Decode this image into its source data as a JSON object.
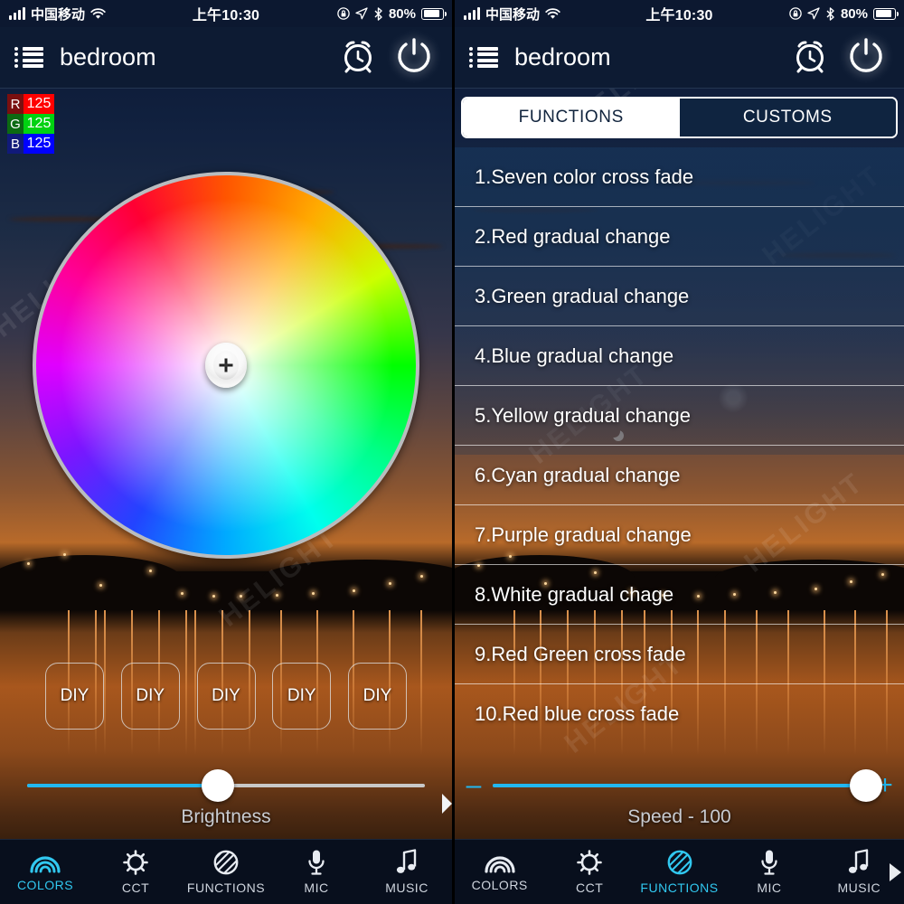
{
  "status_bar": {
    "carrier": "中国移动",
    "signal_icon": "cellular-signal-icon",
    "wifi_icon": "wifi-icon",
    "time": "上午10:30",
    "rotation_lock_icon": "rotation-lock-icon",
    "location_icon": "location-arrow-icon",
    "bluetooth_icon": "bluetooth-icon",
    "battery_percent": "80%",
    "battery_icon": "battery-icon"
  },
  "header": {
    "menu_icon": "hamburger-list-icon",
    "title": "bedroom",
    "alarm_icon": "alarm-clock-icon",
    "power_icon": "power-button-icon"
  },
  "left_panel": {
    "rgb": [
      {
        "channel": "R",
        "value": "125",
        "color": "#ff0000"
      },
      {
        "channel": "G",
        "value": "125",
        "color": "#00d211"
      },
      {
        "channel": "B",
        "value": "125",
        "color": "#0000ff"
      }
    ],
    "color_wheel": {
      "name": "hsv-color-wheel",
      "selector_position_percent": 50
    },
    "diy_buttons": [
      "DIY",
      "DIY",
      "DIY",
      "DIY",
      "DIY"
    ],
    "brightness": {
      "label": "Brightness",
      "percent": 48
    }
  },
  "right_panel": {
    "segmented": {
      "active": "FUNCTIONS",
      "options": [
        "FUNCTIONS",
        "CUSTOMS"
      ]
    },
    "functions": [
      "1.Seven color cross fade",
      "2.Red gradual change",
      "3.Green gradual change",
      "4.Blue gradual change",
      "5.Yellow gradual change",
      "6.Cyan gradual change",
      "7.Purple gradual change",
      "8.White gradual chage",
      "9.Red Green cross fade",
      "10.Red blue cross fade"
    ],
    "speed": {
      "label": "Speed - 100",
      "percent": 100,
      "minus": "–",
      "plus": "+"
    }
  },
  "tabbar": {
    "items": [
      {
        "label": "COLORS",
        "icon": "rainbow-icon"
      },
      {
        "label": "CCT",
        "icon": "sun-gear-icon"
      },
      {
        "label": "FUNCTIONS",
        "icon": "striped-circle-icon"
      },
      {
        "label": "MIC",
        "icon": "microphone-icon"
      },
      {
        "label": "MUSIC",
        "icon": "music-note-icon"
      }
    ],
    "left_active": "COLORS",
    "right_active": "FUNCTIONS",
    "overflow_arrow_icon": "chevron-right-icon"
  },
  "watermark": "HELIGHT",
  "accent_color": "#31c8f0"
}
